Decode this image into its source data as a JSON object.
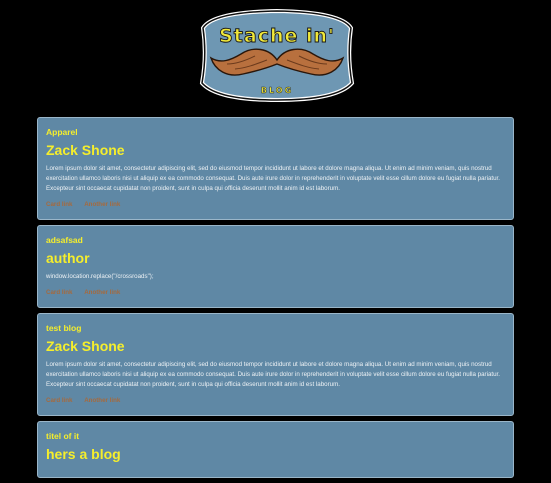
{
  "header": {
    "logo_line1": "Stache in'",
    "logo_line2": "BLOG"
  },
  "cards": [
    {
      "subtitle": "Apparel",
      "title": "Zack Shone",
      "text": "Lorem ipsum dolor sit amet, consectetur adipiscing elit, sed do eiusmod tempor incididunt ut labore et dolore magna aliqua. Ut enim ad minim veniam, quis nostrud exercitation ullamco laboris nisi ut aliquip ex ea commodo consequat. Duis aute irure dolor in reprehenderit in voluptate velit esse cillum dolore eu fugiat nulla pariatur. Excepteur sint occaecat cupidatat non proident, sunt in culpa qui officia deserunt mollit anim id est laborum.",
      "link1": "Card link",
      "link2": "Another link"
    },
    {
      "subtitle": "adsafsad",
      "title": "author",
      "text": "window.location.replace(\"/crossroads\");",
      "link1": "Card link",
      "link2": "Another link"
    },
    {
      "subtitle": "test blog",
      "title": "Zack Shone",
      "text": "Lorem ipsum dolor sit amet, consectetur adipiscing elit, sed do eiusmod tempor incididunt ut labore et dolore magna aliqua. Ut enim ad minim veniam, quis nostrud exercitation ullamco laboris nisi ut aliquip ex ea commodo consequat. Duis aute irure dolor in reprehenderit in voluptate velit esse cillum dolore eu fugiat nulla pariatur. Excepteur sint occaecat cupidatat non proident, sunt in culpa qui officia deserunt mollit anim id est laborum.",
      "link1": "Card link",
      "link2": "Another link"
    },
    {
      "subtitle": "titel of it",
      "title": "hers a blog"
    }
  ],
  "colors": {
    "background": "#000000",
    "card": "#5f88a5",
    "accent_yellow": "#f5ee2c",
    "link_brown": "#a56a3e",
    "mustache": "#b8703e"
  }
}
